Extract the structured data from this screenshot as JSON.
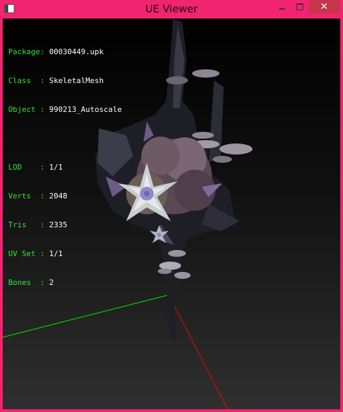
{
  "window": {
    "title": "UE Viewer",
    "icon": "app-icon",
    "controls": {
      "minimize": "minimize-icon",
      "maximize": "maximize-icon",
      "close": "close-icon"
    },
    "close_symbol": "✕"
  },
  "info": {
    "package_label": "Package:",
    "package_value": "00030449.upk",
    "class_label": "Class  :",
    "class_value": "SkeletalMesh",
    "object_label": "Object :",
    "object_value": "990213_Autoscale",
    "lod_label": "LOD    :",
    "lod_value": "1/1",
    "verts_label": "Verts  :",
    "verts_value": "2048",
    "tris_label": "Tris   :",
    "tris_value": "2335",
    "uvset_label": "UV Set :",
    "uvset_value": "1/1",
    "bones_label": "Bones  :",
    "bones_value": "2"
  },
  "colors": {
    "frame": "#f0246f",
    "label_green": "#37e437",
    "value_white": "#ffffff",
    "axis_x": "#ff0000",
    "axis_y": "#00ff00",
    "axis_z": "#0000ff"
  }
}
